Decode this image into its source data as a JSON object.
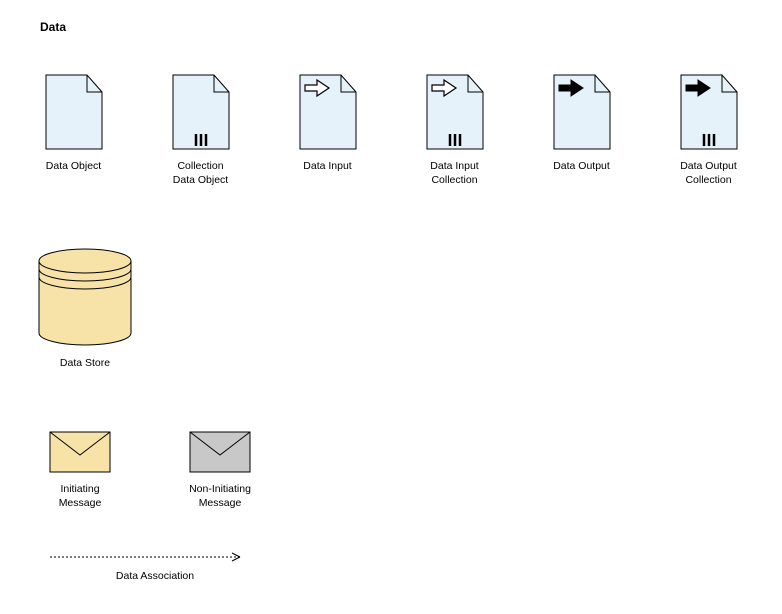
{
  "title": "Data",
  "items": {
    "data_object": "Data Object",
    "collection_data_object": "Collection Data Object",
    "data_input": "Data Input",
    "data_input_collection": "Data Input Collection",
    "data_output": "Data Output",
    "data_output_collection": "Data Output Collection",
    "data_store": "Data Store",
    "initiating_message": "Initiating Message",
    "non_initiating_message": "Non-Initiating Message",
    "data_association": "Data Association"
  }
}
